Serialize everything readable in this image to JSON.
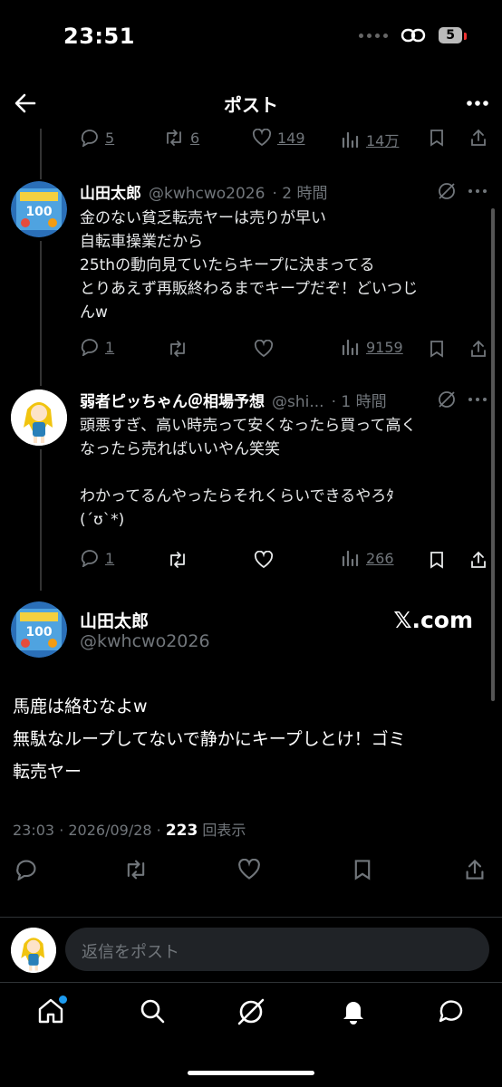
{
  "status_bar": {
    "time": "23:51",
    "battery": "5"
  },
  "header": {
    "title": "ポスト"
  },
  "prev_post_metrics": {
    "replies": "5",
    "retweets": "6",
    "likes": "149",
    "views": "14万"
  },
  "thread": [
    {
      "name": "山田太郎",
      "handle": "@kwhcwo2026",
      "time": "· 2 時間",
      "text": "金のない貧乏転売ヤーは売りが早い\n自転車操業だから\n25thの動向見ていたらキープに決まってる\nとりあえず再販終わるまでキープだぞ！どいつじ\nんw",
      "metrics": {
        "replies": "1",
        "views": "9159"
      }
    },
    {
      "name": "弱者ピッちゃん＠相場予想",
      "handle": "@shi...",
      "time": "· 1 時間",
      "text": "頭悪すぎ、高い時売って安くなったら買って高く\nなったら売ればいいやん笑笑\n\nわかってるんやったらそれくらいできるやろﾀ\n(´ʊ`*)",
      "metrics": {
        "replies": "1",
        "views": "266"
      }
    }
  ],
  "main_post": {
    "name": "山田太郎",
    "handle": "@kwhcwo2026",
    "watermark": "𝕏.com",
    "text": "馬鹿は絡むなよw\n無駄なループしてないで静かにキープしとけ！ゴミ\n転売ヤー",
    "timestamp": "23:03 · 2026/09/28 · ",
    "views_count": "223",
    "views_label": " 回表示"
  },
  "reply": {
    "placeholder": "返信をポスト"
  },
  "colors": {
    "background": "#000000",
    "text": "#e7e9ea",
    "muted": "#71767b",
    "accent": "#1d9bf0"
  }
}
